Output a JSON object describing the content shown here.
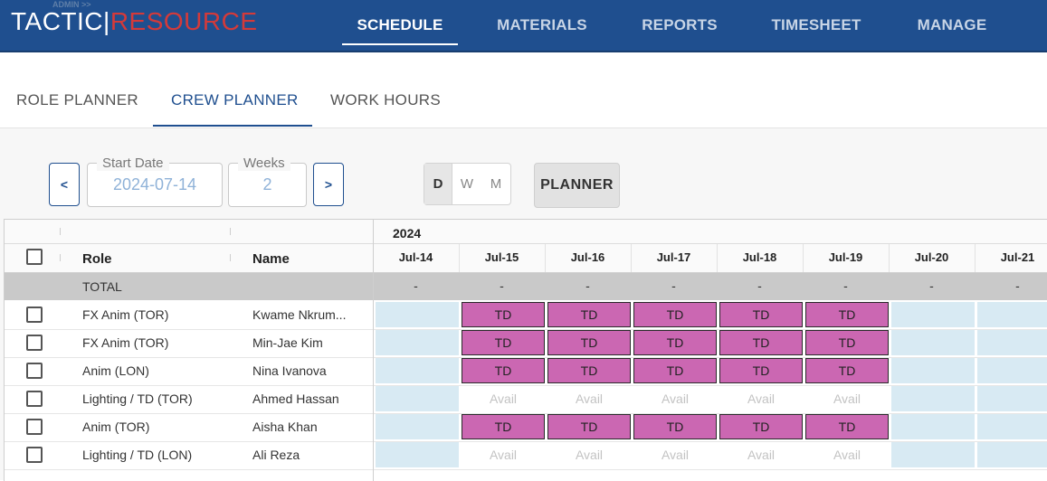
{
  "app": {
    "logo_part1": "TACTIC",
    "logo_sep": "|",
    "logo_part2": "RESOURCE",
    "admin_link": "ADMIN >>",
    "nav": [
      {
        "label": "SCHEDULE",
        "active": true
      },
      {
        "label": "MATERIALS",
        "active": false
      },
      {
        "label": "REPORTS",
        "active": false
      },
      {
        "label": "TIMESHEET",
        "active": false
      },
      {
        "label": "MANAGE",
        "active": false
      }
    ]
  },
  "subtabs": [
    {
      "label": "ROLE PLANNER",
      "active": false
    },
    {
      "label": "CREW PLANNER",
      "active": true
    },
    {
      "label": "WORK HOURS",
      "active": false
    }
  ],
  "controls": {
    "prev_label": "<",
    "next_label": ">",
    "start_date_label": "Start Date",
    "start_date_value": "2024-07-14",
    "weeks_label": "Weeks",
    "weeks_value": "2",
    "view_modes": [
      "D",
      "W",
      "M"
    ],
    "selected_view_mode": "D",
    "planner_button": "PLANNER"
  },
  "grid": {
    "year": "2024",
    "col_role": "Role",
    "col_name": "Name",
    "dates": [
      "Jul-14",
      "Jul-15",
      "Jul-16",
      "Jul-17",
      "Jul-18",
      "Jul-19",
      "Jul-20",
      "Jul-21"
    ],
    "total_label": "TOTAL",
    "total_values": [
      "-",
      "-",
      "-",
      "-",
      "-",
      "-",
      "-",
      "-"
    ],
    "rows": [
      {
        "role": "FX Anim (TOR)",
        "name": "Kwame Nkrum...",
        "cells": [
          "",
          "TD",
          "TD",
          "TD",
          "TD",
          "TD",
          "",
          ""
        ]
      },
      {
        "role": "FX Anim (TOR)",
        "name": "Min-Jae Kim",
        "cells": [
          "",
          "TD",
          "TD",
          "TD",
          "TD",
          "TD",
          "",
          ""
        ]
      },
      {
        "role": "Anim (LON)",
        "name": "Nina Ivanova",
        "cells": [
          "",
          "TD",
          "TD",
          "TD",
          "TD",
          "TD",
          "",
          ""
        ]
      },
      {
        "role": "Lighting / TD (TOR)",
        "name": "Ahmed Hassan",
        "cells": [
          "",
          "Avail",
          "Avail",
          "Avail",
          "Avail",
          "Avail",
          "",
          ""
        ]
      },
      {
        "role": "Anim (TOR)",
        "name": "Aisha Khan",
        "cells": [
          "",
          "TD",
          "TD",
          "TD",
          "TD",
          "TD",
          "",
          ""
        ]
      },
      {
        "role": "Lighting / TD (LON)",
        "name": "Ali Reza",
        "cells": [
          "",
          "Avail",
          "Avail",
          "Avail",
          "Avail",
          "Avail",
          "",
          ""
        ]
      }
    ]
  },
  "colors": {
    "header_bg": "#1f4f8f",
    "logo_accent": "#d43a3a",
    "assigned_cell": "#cb67b2",
    "empty_cell": "#d8eaf3"
  }
}
